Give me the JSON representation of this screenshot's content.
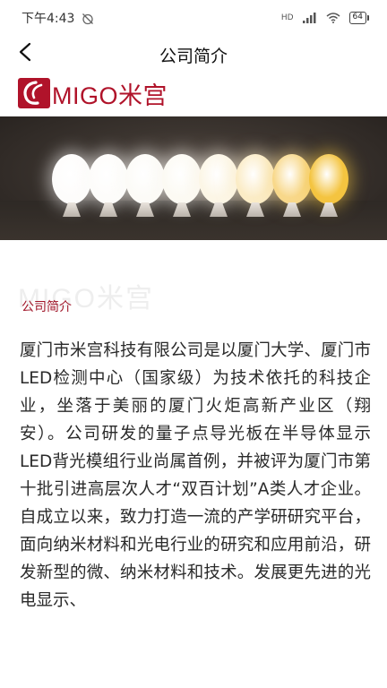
{
  "status_bar": {
    "time": "下午4:43",
    "network_label": "HD",
    "battery": "64"
  },
  "nav": {
    "title": "公司简介"
  },
  "logo": {
    "text": "MIGO米宫",
    "brand_color": "#b0132a"
  },
  "hero": {
    "lamp_colors": [
      "#fdfcfb",
      "#fdfcfa",
      "#fcfbf7",
      "#fcfaf3",
      "#fcf6e6",
      "#fbecc6",
      "#f8d88a",
      "#f4c440"
    ]
  },
  "section": {
    "watermark": "MIGO米宫",
    "title": "公司简介"
  },
  "article": {
    "text": "厦门市米宫科技有限公司是以厦门大学、厦门市LED检测中心（国家级）为技术依托的科技企业，坐落于美丽的厦门火炬高新产业区（翔安）。公司研发的量子点导光板在半导体显示LED背光模组行业尚属首例，并被评为厦门市第十批引进高层次人才“双百计划”A类人才企业。自成立以来，致力打造一流的产学研研究平台，面向纳米材料和光电行业的研究和应用前沿，研发新型的微、纳米材料和技术。发展更先进的光电显示、"
  },
  "icons": {
    "back": "chevron-left-icon",
    "alarm_off": "alarm-off-icon",
    "signal": "signal-icon",
    "wifi": "wifi-icon",
    "battery": "battery-icon"
  }
}
